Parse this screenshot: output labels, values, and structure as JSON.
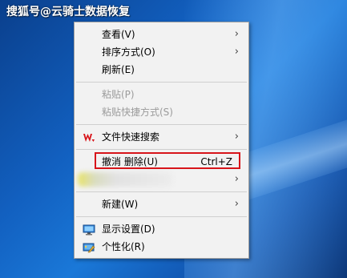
{
  "watermark": "搜狐号@云骑士数据恢复",
  "menu": {
    "view": "查看(V)",
    "sort": "排序方式(O)",
    "refresh": "刷新(E)",
    "paste": "粘贴(P)",
    "paste_shortcut": "粘贴快捷方式(S)",
    "wps_search": "文件快速搜索",
    "undo_delete": "撤消 删除(U)",
    "undo_shortcut": "Ctrl+Z",
    "new": "新建(W)",
    "display": "显示设置(D)",
    "personalize": "个性化(R)"
  },
  "colors": {
    "highlight": "#d7141a",
    "wps_red": "#d7141a"
  },
  "icons": {
    "submenu": "chevron-right-icon",
    "wps": "wps-logo-icon",
    "display": "display-settings-icon",
    "personalize": "personalize-icon"
  }
}
